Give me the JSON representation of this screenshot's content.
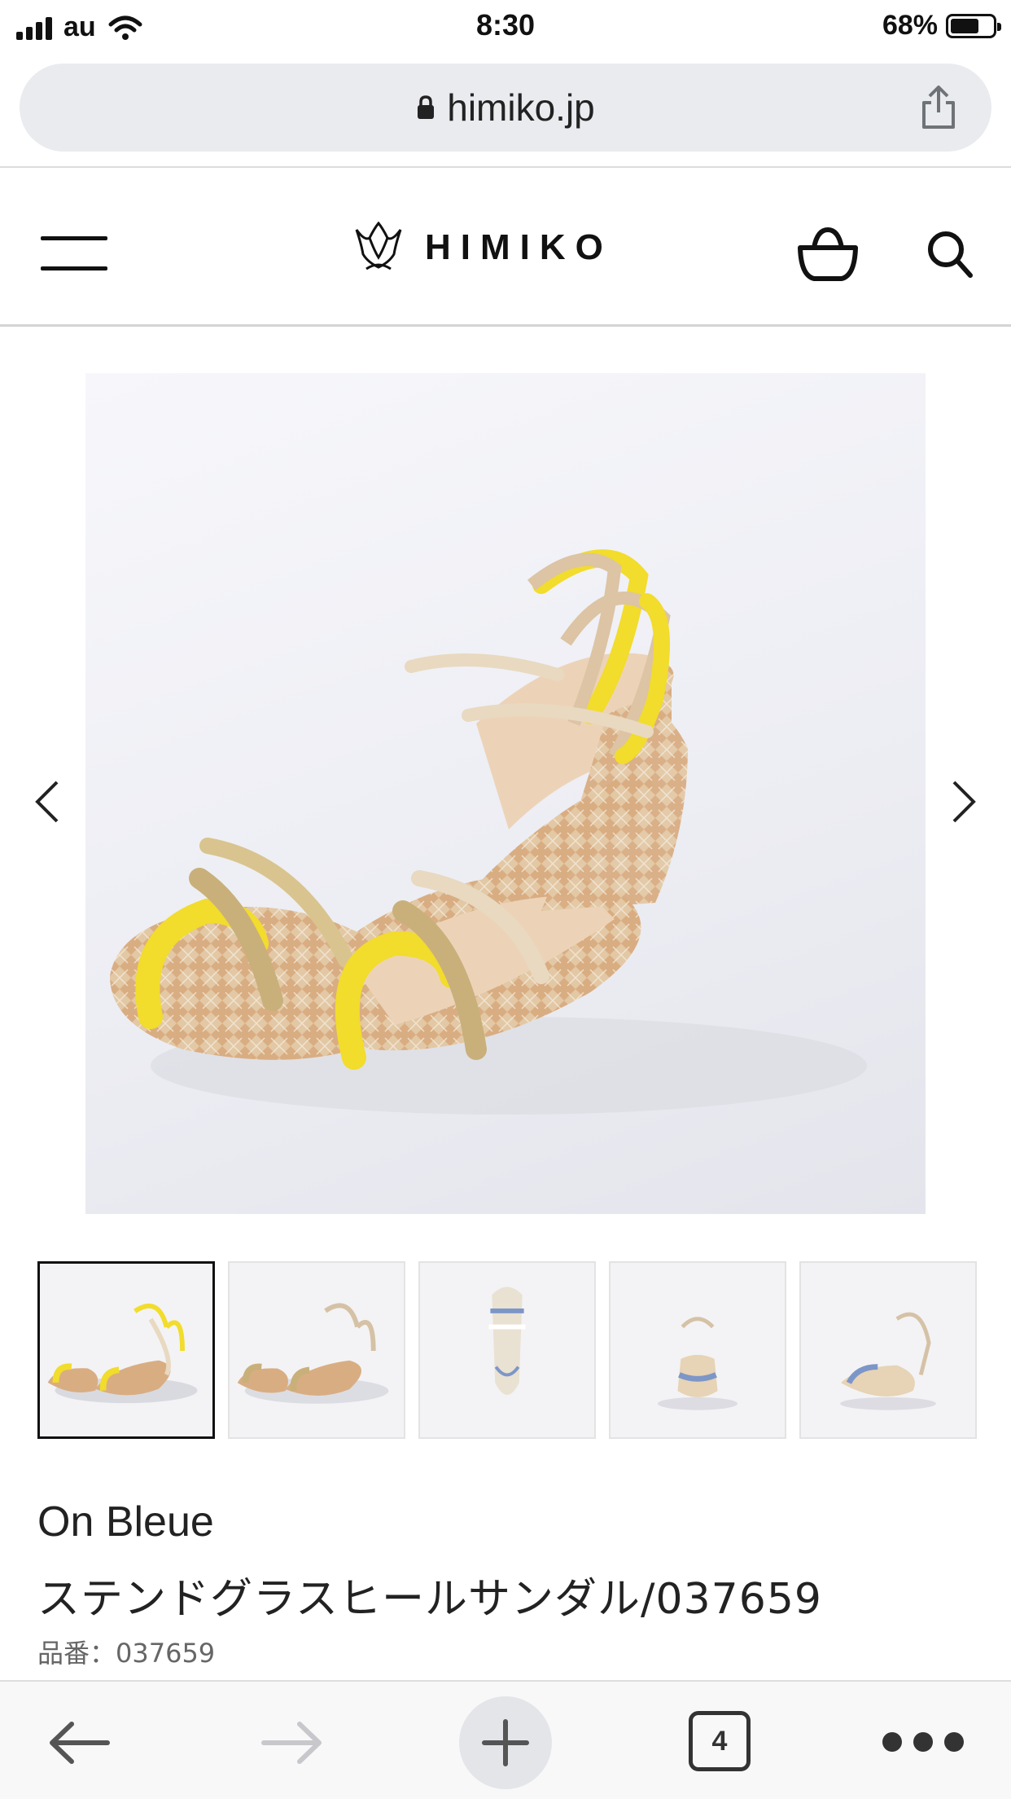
{
  "status_bar": {
    "carrier": "au",
    "time": "8:30",
    "battery_percent": "68%",
    "battery_level": 0.68
  },
  "browser": {
    "url": "himiko.jp"
  },
  "header": {
    "logo_text": "HIMIKO"
  },
  "product": {
    "brand": "On Bleue",
    "name": "ステンドグラスヒールサンダル/037659",
    "code": "品番：037659"
  },
  "gallery": {
    "thumbnail_count": 5,
    "selected_index": 0
  },
  "toolbar": {
    "tab_count": "4"
  },
  "colors": {
    "accent_yellow": "#f2dc2c",
    "strap_beige": "#e8d9c0",
    "sole_cork": "#d7a77a"
  }
}
